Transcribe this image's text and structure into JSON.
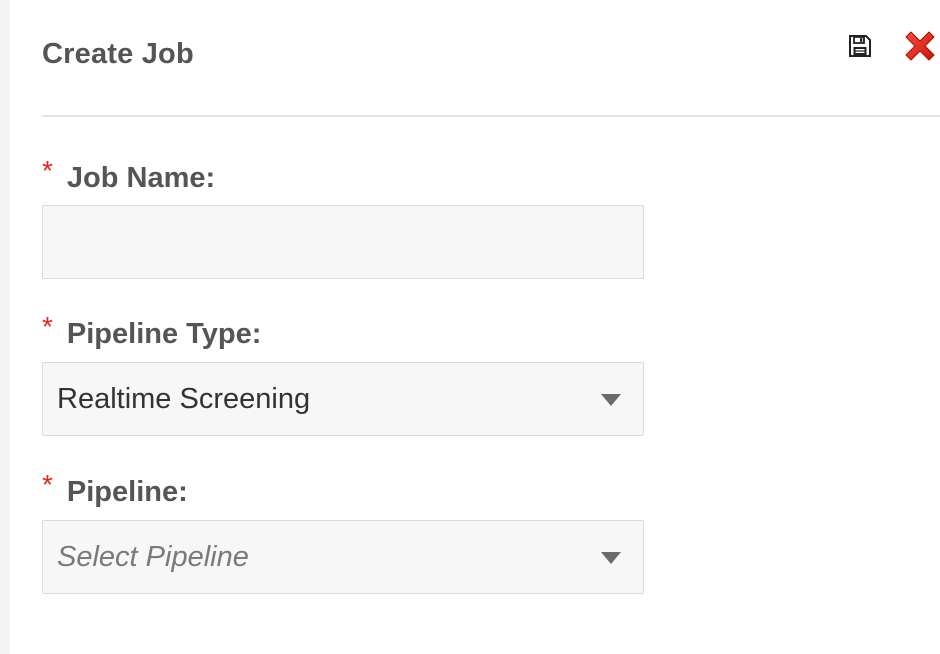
{
  "dialog": {
    "title": "Create Job",
    "save_icon": "floppy-disk-icon",
    "close_icon": "red-x-icon",
    "close_color": "#e8241c"
  },
  "form": {
    "required_marker": "*",
    "job_name": {
      "label": "Job Name:",
      "value": "",
      "placeholder": ""
    },
    "pipeline_type": {
      "label": "Pipeline Type:",
      "selected": "Realtime Screening"
    },
    "pipeline": {
      "label": "Pipeline:",
      "placeholder": "Select Pipeline"
    }
  }
}
